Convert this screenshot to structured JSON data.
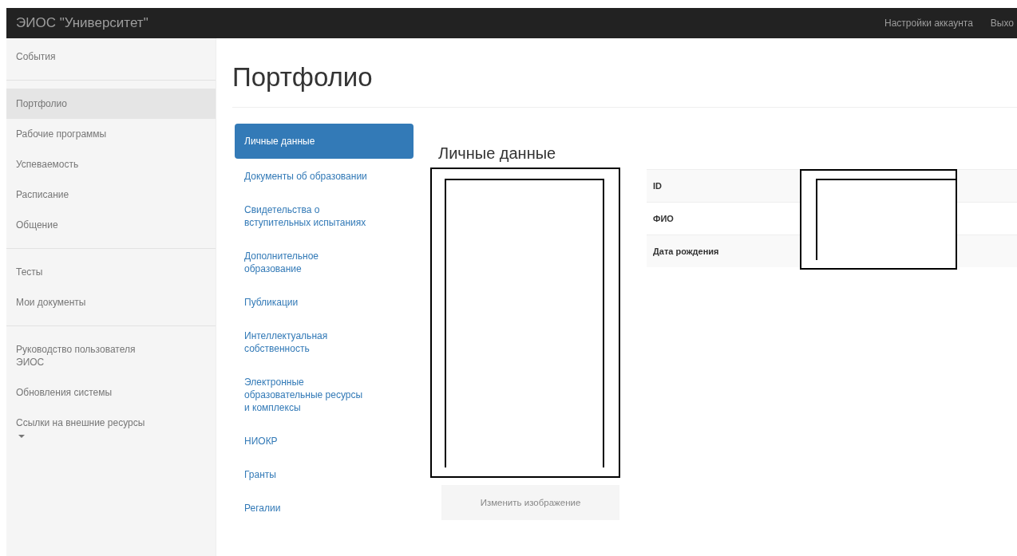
{
  "navbar": {
    "brand": "ЭИОС \"Университет\"",
    "links": [
      "Настройки аккаунта",
      "Выхо"
    ]
  },
  "sidebar": {
    "sections": [
      [
        {
          "label": "События",
          "selected": false,
          "kind": "link"
        }
      ],
      [
        {
          "label": "Портфолио",
          "selected": true,
          "kind": "link"
        },
        {
          "label": "Рабочие программы",
          "selected": false,
          "kind": "link"
        },
        {
          "label": "Успеваемость",
          "selected": false,
          "kind": "link"
        },
        {
          "label": "Расписание",
          "selected": false,
          "kind": "link"
        },
        {
          "label": "Общение",
          "selected": false,
          "kind": "link"
        }
      ],
      [
        {
          "label": "Тесты",
          "selected": false,
          "kind": "link"
        },
        {
          "label": "Мои документы",
          "selected": false,
          "kind": "link"
        }
      ],
      [
        {
          "label": "Руководство пользователя ЭИОС",
          "selected": false,
          "kind": "link"
        },
        {
          "label": "Обновления системы",
          "selected": false,
          "kind": "link"
        },
        {
          "label": "Ссылки на внешние ресурсы",
          "selected": false,
          "kind": "dropdown"
        }
      ]
    ]
  },
  "page_title": "Портфолио",
  "portfolio_nav": [
    {
      "label": "Личные данные",
      "selected": true
    },
    {
      "label": "Документы об образовании",
      "selected": false
    },
    {
      "label": "Свидетельства о вступительных испытаниях",
      "selected": false
    },
    {
      "label": "Дополнительное образование",
      "selected": false
    },
    {
      "label": "Публикации",
      "selected": false
    },
    {
      "label": "Интеллектуальная собственность",
      "selected": false
    },
    {
      "label": "Электронные образовательные ресурсы и комплексы",
      "selected": false
    },
    {
      "label": "НИОКР",
      "selected": false
    },
    {
      "label": "Гранты",
      "selected": false
    },
    {
      "label": "Регалии",
      "selected": false
    }
  ],
  "section_title": "Личные данные",
  "change_image_button": "Изменить изображение",
  "table": {
    "rows": [
      {
        "label": "ID"
      },
      {
        "label": "ФИО"
      },
      {
        "label": "Дата рождения"
      }
    ]
  }
}
